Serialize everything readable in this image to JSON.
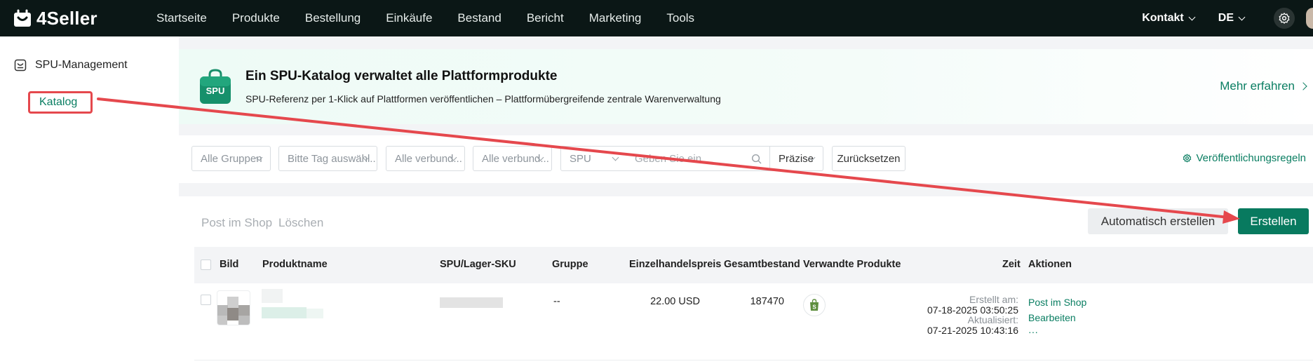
{
  "app": {
    "name": "4Seller"
  },
  "nav": {
    "items": [
      "Startseite",
      "Produkte",
      "Bestellung",
      "Einkäufe",
      "Bestand",
      "Bericht",
      "Marketing",
      "Tools"
    ]
  },
  "top_right": {
    "contact": "Kontakt",
    "language": "DE"
  },
  "sidebar": {
    "group": "SPU-Management",
    "items": [
      {
        "label": "Katalog",
        "active": true
      }
    ]
  },
  "banner": {
    "badge": "SPU",
    "title": "Ein SPU-Katalog verwaltet alle Plattformprodukte",
    "subtitle": "SPU-Referenz per 1-Klick auf Plattformen veröffentlichen – Plattformübergreifende zentrale Warenverwaltung",
    "link": "Mehr erfahren"
  },
  "filters": {
    "group": "Alle Gruppen",
    "tag": "Bitte Tag auswähl...",
    "linked1": "Alle verbund...",
    "linked2": "Alle verbund...",
    "field": "SPU",
    "search_placeholder": "Geben Sie ein",
    "mode": "Präzise",
    "reset": "Zurücksetzen",
    "rules": "Veröffentlichungsregeln"
  },
  "actions": {
    "post": "Post im Shop",
    "delete": "Löschen",
    "auto_create": "Automatisch erstellen",
    "create": "Erstellen"
  },
  "table": {
    "headers": {
      "image": "Bild",
      "name": "Produktname",
      "sku": "SPU/Lager-SKU",
      "group": "Gruppe",
      "price": "Einzelhandelspreis",
      "stock": "Gesamtbestand",
      "related": "Verwandte Produkte",
      "time": "Zeit",
      "actions": "Aktionen"
    },
    "rows": [
      {
        "group": "--",
        "price": "22.00 USD",
        "stock": "187470",
        "created_label": "Erstellt am:",
        "created": "07-18-2025 03:50:25",
        "updated_label": "Aktualisiert:",
        "updated": "07-21-2025 10:43:16",
        "action_post": "Post im Shop",
        "action_edit": "Bearbeiten",
        "action_more": "···"
      }
    ]
  },
  "colors": {
    "accent": "#087a5f",
    "topbar": "#0b1716",
    "highlight": "#e5484d"
  }
}
